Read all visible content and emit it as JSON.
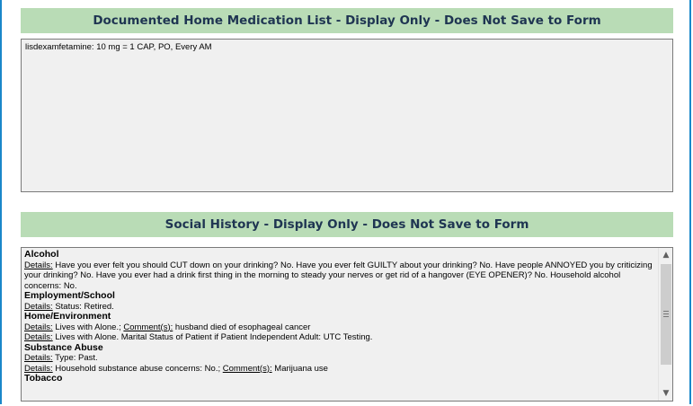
{
  "medication": {
    "banner": "Documented Home Medication List - Display Only - Does Not Save to Form",
    "text": "lisdexamfetamine: 10 mg = 1 CAP, PO, Every AM"
  },
  "social": {
    "banner": "Social History - Display Only - Does Not Save to Form",
    "alcohol": {
      "heading": "Alcohol",
      "details_label": "Details:",
      "details_text": " Have you ever felt you should CUT down on your drinking? No.  Have you ever felt GUILTY about your drinking? No.  Have people ANNOYED you by criticizing your drinking? No.  Have you ever had a drink first thing in the morning to steady your nerves or get rid of a hangover (EYE OPENER)? No.  Household alcohol concerns: No."
    },
    "employment": {
      "heading": "Employment/School",
      "details_label": "Details:",
      "details_text": " Status: Retired."
    },
    "home": {
      "heading": "Home/Environment",
      "line1_label": "Details:",
      "line1_text": " Lives with Alone.; ",
      "line1_comment_label": "Comment(s):",
      "line1_comment_text": " husband died of esophageal cancer",
      "line2_label": "Details:",
      "line2_text": " Lives with Alone.  Marital Status of Patient if Patient Independent Adult: UTC Testing."
    },
    "substance": {
      "heading": "Substance Abuse",
      "line1_label": "Details:",
      "line1_text": " Type: Past.",
      "line2_label": "Details:",
      "line2_text": " Household substance abuse concerns: No.; ",
      "line2_comment_label": "Comment(s):",
      "line2_comment_text": " Marijuana use"
    },
    "tobacco": {
      "heading": "Tobacco"
    }
  },
  "icons": {
    "scroll_up": "▲",
    "scroll_down": "▼"
  }
}
